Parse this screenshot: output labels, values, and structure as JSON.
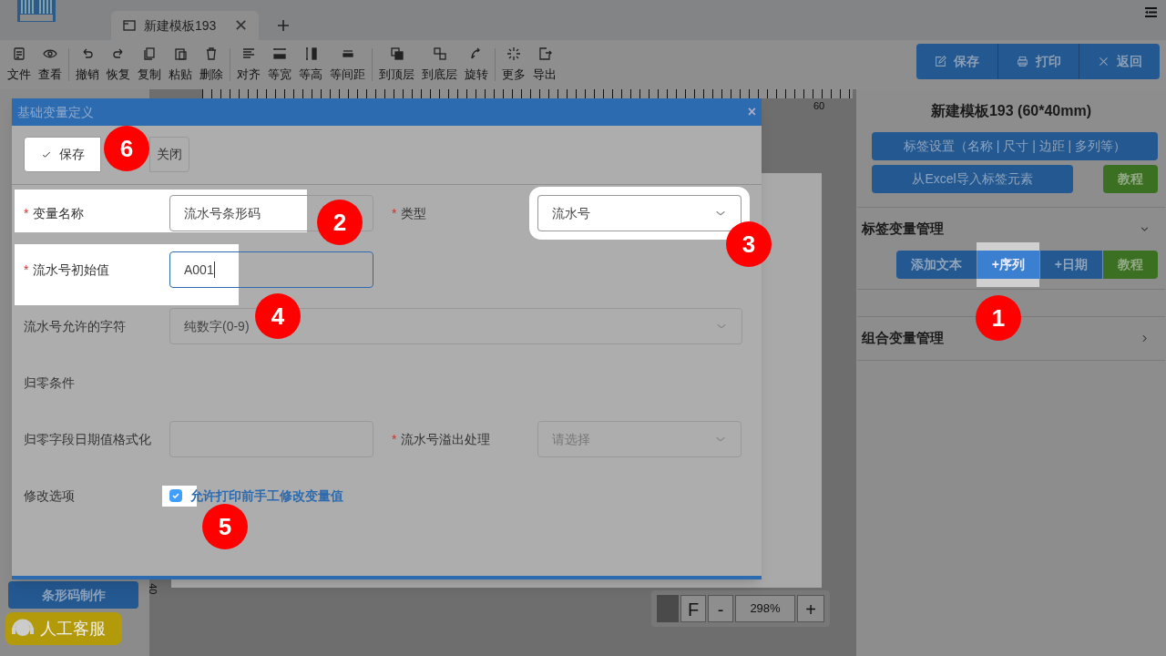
{
  "tabs": [
    {
      "label": "新建模板193",
      "selected": true,
      "close": "✕"
    }
  ],
  "toolbar": [
    [
      {
        "label": "文件"
      },
      {
        "label": "查看"
      }
    ],
    [
      {
        "label": "撤销"
      },
      {
        "label": "恢复"
      },
      {
        "label": "复制"
      },
      {
        "label": "粘贴"
      },
      {
        "label": "删除"
      }
    ],
    [
      {
        "label": "对齐"
      },
      {
        "label": "等宽"
      },
      {
        "label": "等高"
      },
      {
        "label": "等间距"
      }
    ],
    [
      {
        "label": "到顶层"
      },
      {
        "label": "到底层"
      },
      {
        "label": "旋转"
      }
    ],
    [
      {
        "label": "更多"
      },
      {
        "label": "导出"
      }
    ]
  ],
  "header_actions": [
    "保存",
    "打印",
    "返回"
  ],
  "ruler": {
    "top_mark": "60",
    "left_mark": "40"
  },
  "zoom_controls": {
    "buttons": [
      "F",
      "-"
    ],
    "value": "298%",
    "plus": "+"
  },
  "left_panel": {
    "buttons": [
      "条形码制作"
    ],
    "support": "人工客服"
  },
  "dialog": {
    "title": "基础变量定义",
    "close": "×",
    "buttons": [
      {
        "label": "保存",
        "spotlight": true
      },
      {
        "label": "关闭",
        "spotlight": false
      }
    ],
    "rows": [
      [
        {
          "kind": "input",
          "required_mark": "*",
          "label": "变量名称",
          "value": "流水号条形码",
          "spotlight": true,
          "focused": false
        },
        {
          "kind": "select",
          "required_mark": "*",
          "label": "类型",
          "value": "流水号",
          "spotlight": true
        }
      ],
      [
        {
          "kind": "input",
          "required_mark": "*",
          "label": "流水号初始值",
          "value": "A001",
          "spotlight": true,
          "focused": true
        }
      ],
      [
        {
          "kind": "select_wide",
          "label": "流水号允许的字符",
          "value": "纯数字(0-9)",
          "spotlight": false
        }
      ],
      [
        {
          "kind": "heading",
          "label": "归零条件"
        }
      ],
      [
        {
          "kind": "input",
          "label": "归零字段日期值格式化",
          "spotlight": false,
          "focused": false
        },
        {
          "kind": "select",
          "required_mark": "*",
          "label": "流水号溢出处理",
          "placeholder": "请选择",
          "spotlight": false
        }
      ],
      [
        {
          "kind": "checkbox",
          "label": "修改选项",
          "text": "允许打印前手工修改变量值",
          "checked": true,
          "spotlight": true
        }
      ]
    ]
  },
  "right_panel": {
    "title": "新建模板193 (60*40mm)",
    "settings_button": "标签设置（名称 | 尺寸 | 边距 | 多列等）",
    "import_button": "从Excel导入标签元素",
    "tutorial_button": "教程",
    "sections": [
      {
        "title": "标签变量管理",
        "expanded": true,
        "buttons": [
          {
            "label": "添加文本",
            "kind": "blue",
            "spotlight": false
          },
          {
            "label": "+序列",
            "kind": "blue",
            "spotlight": true
          },
          {
            "label": "+日期",
            "kind": "blue",
            "spotlight": false
          },
          {
            "label": "教程",
            "kind": "green",
            "spotlight": false
          }
        ]
      },
      {
        "title": "组合变量管理",
        "expanded": false
      }
    ]
  },
  "annotations": [
    "1",
    "2",
    "3",
    "4",
    "5",
    "6"
  ]
}
